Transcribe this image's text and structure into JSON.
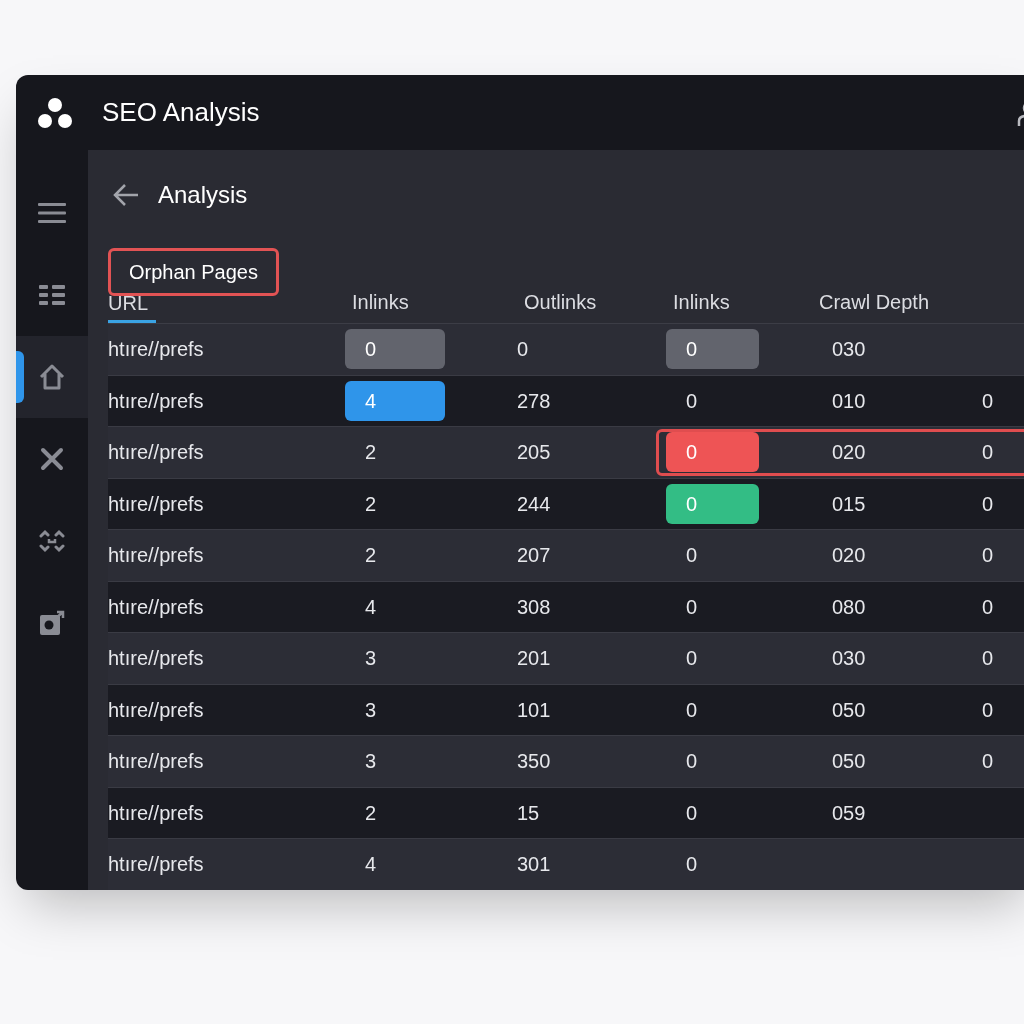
{
  "app": {
    "title": "SEO Analysis"
  },
  "sidebar": {
    "items": [
      {
        "kind": "menu",
        "selected": false
      },
      {
        "kind": "grid",
        "selected": false
      },
      {
        "kind": "home",
        "selected": true
      },
      {
        "kind": "close",
        "selected": false
      },
      {
        "kind": "scan",
        "selected": false
      },
      {
        "kind": "export",
        "selected": false
      }
    ]
  },
  "page": {
    "title": "Analysis",
    "callout": "Orphan Pages"
  },
  "table": {
    "columns": [
      "URL",
      "Inlinks",
      "Outlinks",
      "Inlinks",
      "Crawl Depth"
    ],
    "rows": [
      {
        "flagged": false,
        "cells": [
          "htıre//prefs",
          {
            "text": "0",
            "color": "#62646d"
          },
          "0",
          {
            "text": "0",
            "color": "#62646d"
          },
          "030"
        ]
      },
      {
        "flagged": false,
        "cells": [
          "htıre//prefs",
          {
            "text": "4",
            "color": "#2f95ea"
          },
          "278",
          "0",
          "010",
          "0"
        ]
      },
      {
        "flagged": true,
        "cells": [
          "htıre//prefs",
          "2",
          "205",
          {
            "text": "0",
            "color": "#ee5455"
          },
          "020",
          "0"
        ]
      },
      {
        "flagged": false,
        "cells": [
          "htıre//prefs",
          "2",
          "244",
          {
            "text": "0",
            "color": "#33bd85"
          },
          "015",
          "0"
        ]
      },
      {
        "flagged": false,
        "cells": [
          "htıre//prefs",
          "2",
          "207",
          "0",
          "020",
          "0"
        ]
      },
      {
        "flagged": false,
        "cells": [
          "htıre//prefs",
          "4",
          "308",
          "0",
          "080",
          "0"
        ]
      },
      {
        "flagged": false,
        "cells": [
          "htıre//prefs",
          "3",
          "201",
          "0",
          "030",
          "0"
        ]
      },
      {
        "flagged": false,
        "cells": [
          "htıre//prefs",
          "3",
          "101",
          "0",
          "050",
          "0"
        ]
      },
      {
        "flagged": false,
        "cells": [
          "htıre//prefs",
          "3",
          "350",
          "0",
          "050",
          "0"
        ]
      },
      {
        "flagged": false,
        "cells": [
          "htıre//prefs",
          "2",
          "15",
          "0",
          "059"
        ]
      },
      {
        "flagged": false,
        "cells": [
          "htıre//prefs",
          "4",
          "301",
          "0"
        ]
      }
    ]
  }
}
